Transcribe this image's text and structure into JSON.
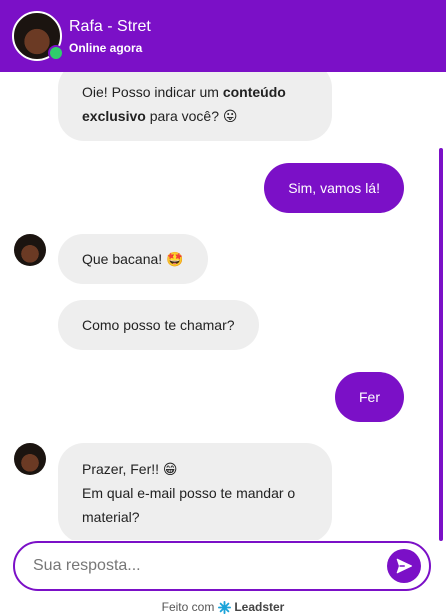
{
  "header": {
    "name": "Rafa - Stret",
    "status": "Online agora"
  },
  "messages": {
    "m1_part1": "Oie! Posso indicar um ",
    "m1_bold1": "conteúdo",
    "m1_bold2": "exclusivo",
    "m1_part2": " para você? 😛",
    "m2": "Sim, vamos lá!",
    "m3": "Que bacana! 🤩",
    "m4": "Como posso te chamar?",
    "m5": "Fer",
    "m6_line1": "Prazer, Fer!! 😁",
    "m6_line2": "Em qual e-mail posso te mandar o",
    "m6_line3": "material?"
  },
  "input": {
    "placeholder": "Sua resposta..."
  },
  "footer": {
    "prefix": "Feito com",
    "brand": "Leadster"
  },
  "colors": {
    "accent": "#7b10c7",
    "online": "#2fce6c",
    "bot_bubble": "#eeeeee"
  }
}
